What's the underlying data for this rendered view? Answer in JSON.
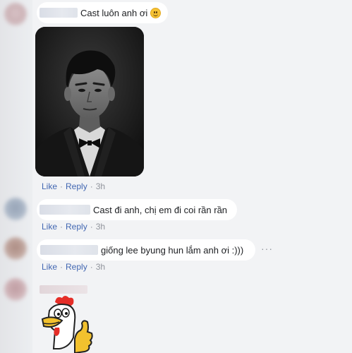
{
  "comments": [
    {
      "text": "Cast luôn anh ơi",
      "has_emoji": "smiley-emoji",
      "actions": {
        "like": "Like",
        "reply": "Reply",
        "time": "3h"
      }
    },
    {
      "text": "Cast đi anh, chị em đi coi rần rần",
      "actions": {
        "like": "Like",
        "reply": "Reply",
        "time": "3h"
      }
    },
    {
      "text": "giống lee byung hun lắm anh ơi :)))",
      "more": "···",
      "actions": {
        "like": "Like",
        "reply": "Reply",
        "time": "3h"
      }
    }
  ],
  "colors": {
    "background": "#f2f3f5",
    "bubble": "#ffffff",
    "link": "#4267b2",
    "meta": "#90949c"
  },
  "separator": "·"
}
